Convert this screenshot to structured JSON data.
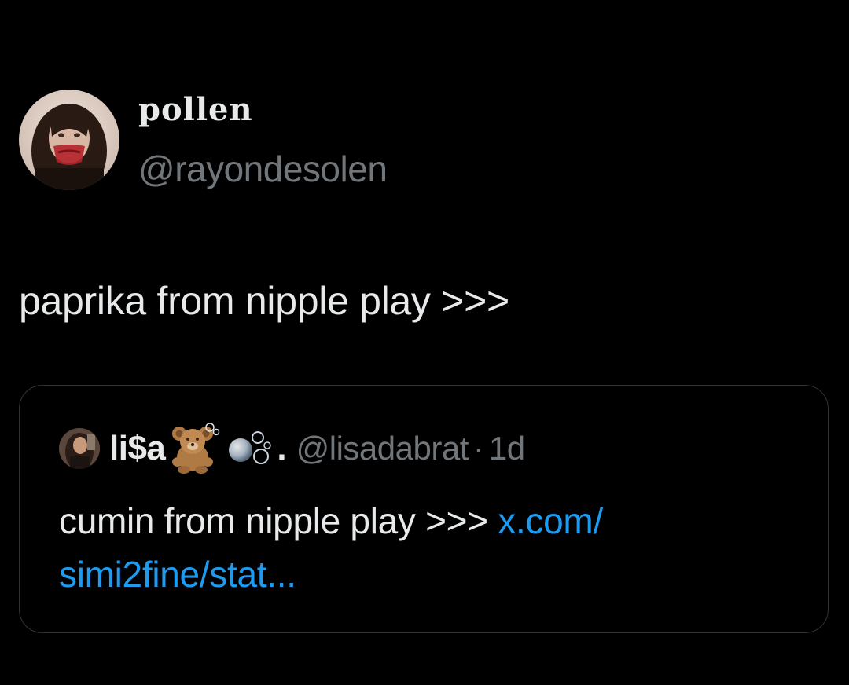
{
  "tweet": {
    "display_name": "pollen",
    "handle": "@rayondesolen",
    "text": "paprika from nipple play >>>",
    "avatar_icon": "profile-photo"
  },
  "quoted_tweet": {
    "display_name": "li$a",
    "name_emojis": [
      "teddy-bear",
      "bubbles"
    ],
    "name_suffix": ".",
    "handle": "@lisadabrat",
    "separator": "·",
    "time": "1d",
    "text": "cumin from nipple play >>> ",
    "link_line1": "x.com/",
    "link_line2": "simi2fine/stat...",
    "avatar_icon": "profile-photo"
  },
  "colors": {
    "background": "#000000",
    "text_primary": "#e7e9ea",
    "text_secondary": "#71767b",
    "link": "#1d9bf0",
    "border": "#2f3336"
  }
}
